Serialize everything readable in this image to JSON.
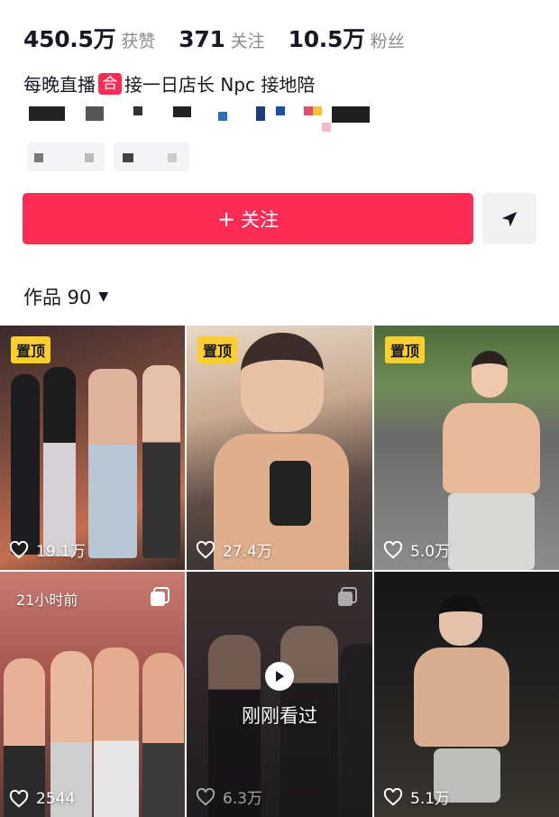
{
  "profile": {
    "stats": [
      {
        "value": "450.5万",
        "label": "获赞"
      },
      {
        "value": "371",
        "label": "关注"
      },
      {
        "value": "10.5万",
        "label": "粉丝"
      }
    ],
    "bio": {
      "before": "每晚直播",
      "badge": "合",
      "after": "接一日店长 Npc 接地陪"
    }
  },
  "actions": {
    "follow_label": "关注",
    "follow_icon": "plus-icon",
    "share_icon": "paper-plane-icon"
  },
  "works": {
    "tab_label": "作品 90",
    "items": [
      {
        "badge": "置顶",
        "likes": "19.1万"
      },
      {
        "badge": "置顶",
        "likes": "27.4万"
      },
      {
        "badge": "置顶",
        "likes": "5.0万"
      },
      {
        "time": "21小时前",
        "likes": "2544",
        "multi": true
      },
      {
        "watched": "刚刚看过",
        "likes": "6.3万",
        "multi": true
      },
      {
        "likes": "5.1万"
      }
    ]
  },
  "colors": {
    "accent": "#fe2c55",
    "pin": "#f9cf2b",
    "label": "#8a8b91"
  }
}
